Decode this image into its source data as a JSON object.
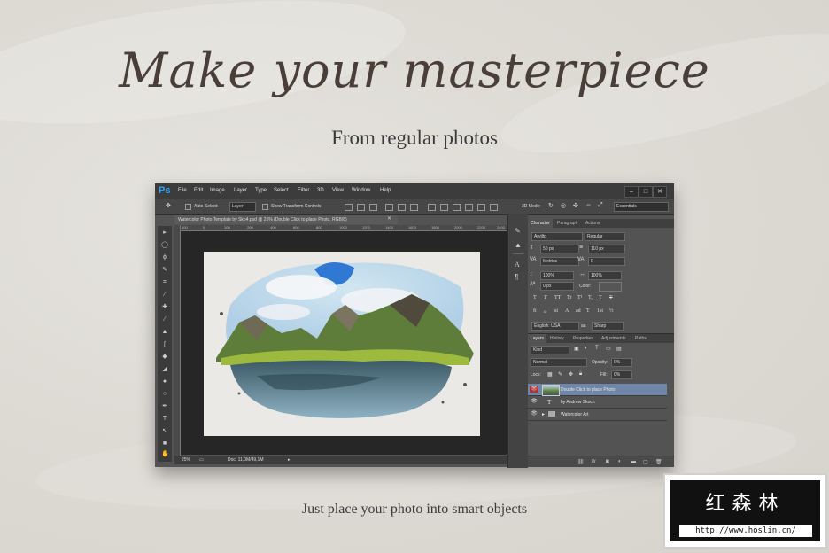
{
  "hero": {
    "headline": "Make your masterpiece",
    "subheadline": "From regular photos",
    "footer": "Just place your photo into smart objects"
  },
  "app": {
    "logo": "Ps",
    "menu": [
      "File",
      "Edit",
      "Image",
      "Layer",
      "Type",
      "Select",
      "Filter",
      "3D",
      "View",
      "Window",
      "Help"
    ],
    "window_controls": [
      "–",
      "□",
      "✕"
    ]
  },
  "options_bar": {
    "auto_select_label": "Auto-Select:",
    "auto_select_value": "Layer",
    "show_transform_label": "Show Transform Controls",
    "mode_3d_label": "3D Mode:",
    "workspace": "Essentials",
    "auto_select_checked": false,
    "show_transform_checked": false
  },
  "document": {
    "tab_title": "Watercolor Photo Template by Sko4.psd @ 25% (Double Click to place Photo, RGB/8)",
    "ruler_ticks": [
      "100",
      "0",
      "100",
      "200",
      "400",
      "600",
      "800",
      "1000",
      "1200",
      "1400",
      "1600",
      "1800",
      "2000",
      "2200",
      "2400"
    ],
    "zoom": "25%",
    "doc_size": "Doc: 11,0M/49,1M"
  },
  "character_panel": {
    "tabs": [
      "Character",
      "Paragraph",
      "Actions"
    ],
    "font_family": "Arvilto",
    "font_style": "Regular",
    "font_size": "50 px",
    "leading": "110 px",
    "kerning": "Metrics",
    "tracking": "0",
    "vertical_scale": "100%",
    "horizontal_scale": "100%",
    "baseline_shift": "0 px",
    "color_label": "Color:",
    "style_glyphs": [
      "T",
      "T",
      "TT",
      "Tr",
      "T¹",
      "T,",
      "T",
      "T"
    ],
    "opentype_glyphs": [
      "fi",
      "ℴ",
      "st",
      "A",
      "ad",
      "T",
      "1st",
      "½"
    ],
    "language": "English: USA",
    "antialias_label": "aa",
    "antialias": "Sharp"
  },
  "layers_panel": {
    "tabs": [
      "Layers",
      "History",
      "Properties",
      "Adjustments",
      "Paths"
    ],
    "filter": "Kind",
    "blend_mode": "Normal",
    "opacity_label": "Opacity:",
    "opacity": "0%",
    "lock_label": "Lock:",
    "fill_label": "Fill:",
    "fill": "0%",
    "layers": [
      {
        "name": "Double Click to place Photo",
        "type": "smart-object",
        "selected": true
      },
      {
        "name": "by Andrew   Skoch",
        "type": "text",
        "selected": false
      },
      {
        "name": "Watercolor Art",
        "type": "group",
        "selected": false
      }
    ],
    "footer_icons": [
      "link",
      "fx",
      "mask",
      "adjustment",
      "folder",
      "new-layer",
      "trash"
    ]
  },
  "watermark": {
    "brand": "红森林",
    "url": "http://www.hoslin.cn/"
  },
  "colors": {
    "ps_blue": "#31a8ff",
    "selection": "#6f86a9",
    "visibility_red": "#b5322f"
  }
}
